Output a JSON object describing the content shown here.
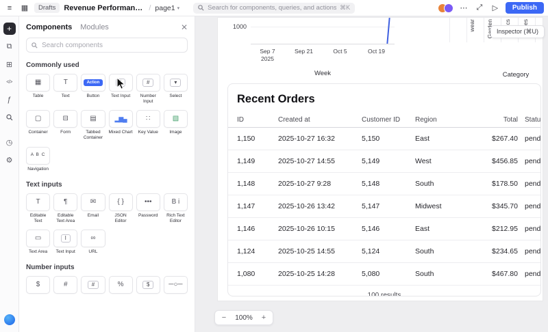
{
  "colors": {
    "accent": "#3c68f5",
    "rail_active": "#2a2a31",
    "avatar1": "#e8833a",
    "avatar2": "#7a5af5"
  },
  "header": {
    "menu_glyph": "≡",
    "grid_glyph": "▦",
    "drafts_label": "Drafts",
    "app_title": "Revenue Performance Da...",
    "separator": "/",
    "page_name": "page1",
    "page_chevron": "▾",
    "search_placeholder": "Search for components, queries, and actions",
    "search_shortcut": "⌘K",
    "more_glyph": "⋯",
    "expand_glyph": "⤢",
    "play_glyph": "▷",
    "publish_label": "Publish"
  },
  "rail": {
    "add_glyph": "+",
    "pages_glyph": "⧉",
    "blocks_glyph": "⊞",
    "code_glyph": "</>",
    "fx_glyph": "ƒ",
    "history_glyph": "◷",
    "settings_glyph": "⚙"
  },
  "components_panel": {
    "tabs": {
      "components": "Components",
      "modules": "Modules"
    },
    "close_glyph": "✕",
    "search_placeholder": "Search components",
    "sections": [
      {
        "title": "Commonly used",
        "items": [
          {
            "label": "Table",
            "glyph": "▦"
          },
          {
            "label": "Text",
            "glyph": "T"
          },
          {
            "label": "Button",
            "glyph": "Action",
            "variant": "accent"
          },
          {
            "label": "Text Input",
            "glyph": "I",
            "variant": "boxed"
          },
          {
            "label": "Number Input",
            "glyph": "#",
            "variant": "boxed"
          },
          {
            "label": "Select",
            "glyph": "▾",
            "variant": "boxed"
          },
          {
            "label": "Container",
            "glyph": "▢"
          },
          {
            "label": "Form",
            "glyph": "⊟"
          },
          {
            "label": "Tabbed Container",
            "glyph": "▤"
          },
          {
            "label": "Mixed Chart",
            "glyph": "▂▆▄",
            "variant": "chart"
          },
          {
            "label": "Key Value",
            "glyph": "∷"
          },
          {
            "label": "Image",
            "glyph": "▧",
            "variant": "image"
          },
          {
            "label": "Navigation",
            "glyph": "A B C",
            "variant": "nav"
          }
        ]
      },
      {
        "title": "Text inputs",
        "items": [
          {
            "label": "Editable Text",
            "glyph": "T"
          },
          {
            "label": "Editable Text Area",
            "glyph": "¶"
          },
          {
            "label": "Email",
            "glyph": "✉"
          },
          {
            "label": "JSON Editor",
            "glyph": "{ }"
          },
          {
            "label": "Password",
            "glyph": "•••"
          },
          {
            "label": "Rich Text Editor",
            "glyph": "B i"
          },
          {
            "label": "Text Area",
            "glyph": "▭"
          },
          {
            "label": "Text Input",
            "glyph": "I",
            "variant": "boxed"
          },
          {
            "label": "URL",
            "glyph": "∞"
          }
        ]
      },
      {
        "title": "Number inputs",
        "items": [
          {
            "glyph": "$"
          },
          {
            "glyph": "#"
          },
          {
            "glyph": "#",
            "variant": "boxed"
          },
          {
            "glyph": "%"
          },
          {
            "glyph": "$",
            "variant": "boxed"
          },
          {
            "glyph": "─○─"
          }
        ]
      }
    ]
  },
  "canvas": {
    "inspector_label": "Inspector (⌘U)",
    "chart": {
      "y_tick": "1000",
      "x_ticks": [
        "Sep 7\n2025",
        "Sep 21",
        "Oct 5",
        "Oct 19"
      ],
      "x_axis_label": "Week",
      "categories": [
        "wear",
        "Garden",
        "ics",
        "ries"
      ],
      "category_axis_label": "Category"
    },
    "recent_orders": {
      "title": "Recent Orders",
      "columns": [
        "ID",
        "Created at",
        "Customer ID",
        "Region",
        "Total",
        "Status"
      ],
      "rows": [
        [
          "1,150",
          "2025-10-27 16:32",
          "5,150",
          "East",
          "$267.40",
          "pending"
        ],
        [
          "1,149",
          "2025-10-27 14:55",
          "5,149",
          "West",
          "$456.85",
          "pending"
        ],
        [
          "1,148",
          "2025-10-27 9:28",
          "5,148",
          "South",
          "$178.50",
          "pending"
        ],
        [
          "1,147",
          "2025-10-26 13:42",
          "5,147",
          "Midwest",
          "$345.70",
          "pending"
        ],
        [
          "1,146",
          "2025-10-26 10:15",
          "5,146",
          "East",
          "$212.95",
          "pending"
        ],
        [
          "1,124",
          "2025-10-25 14:55",
          "5,124",
          "South",
          "$234.65",
          "pending"
        ],
        [
          "1,080",
          "2025-10-25 14:28",
          "5,080",
          "South",
          "$467.80",
          "pending"
        ]
      ],
      "footer": "100 results"
    },
    "zoom": {
      "minus": "−",
      "level": "100%",
      "plus": "+"
    }
  }
}
